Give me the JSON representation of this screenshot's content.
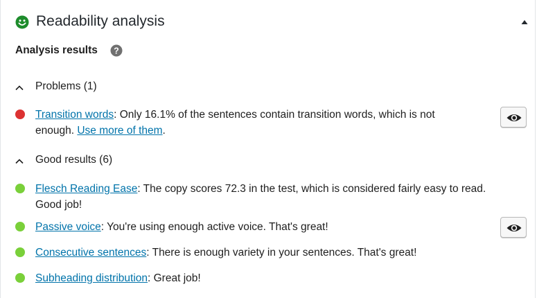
{
  "header": {
    "title": "Readability analysis",
    "status_color": "#1e8c2c"
  },
  "analysis": {
    "heading": "Analysis results"
  },
  "problems": {
    "label": "Problems (1)",
    "items": [
      {
        "link": "Transition words",
        "text": ": Only 16.1% of the sentences contain transition words, which is not",
        "text2": "enough. ",
        "link2": "Use more of them",
        "tail": ".",
        "status": "red"
      }
    ]
  },
  "good": {
    "label": "Good results (6)",
    "items": [
      {
        "link": "Flesch Reading Ease",
        "text": ": The copy scores 72.3 in the test, which is considered fairly easy to read.",
        "text2": "Good job!",
        "status": "green"
      },
      {
        "link": "Passive voice",
        "text": ": You're using enough active voice. That's great!",
        "status": "green"
      },
      {
        "link": "Consecutive sentences",
        "text": ": There is enough variety in your sentences. That's great!",
        "status": "green"
      },
      {
        "link": "Subheading distribution",
        "text": ": Great job!",
        "status": "green"
      }
    ]
  },
  "colors": {
    "link": "#0073aa",
    "red": "#dc3232",
    "green": "#7ad03a"
  }
}
